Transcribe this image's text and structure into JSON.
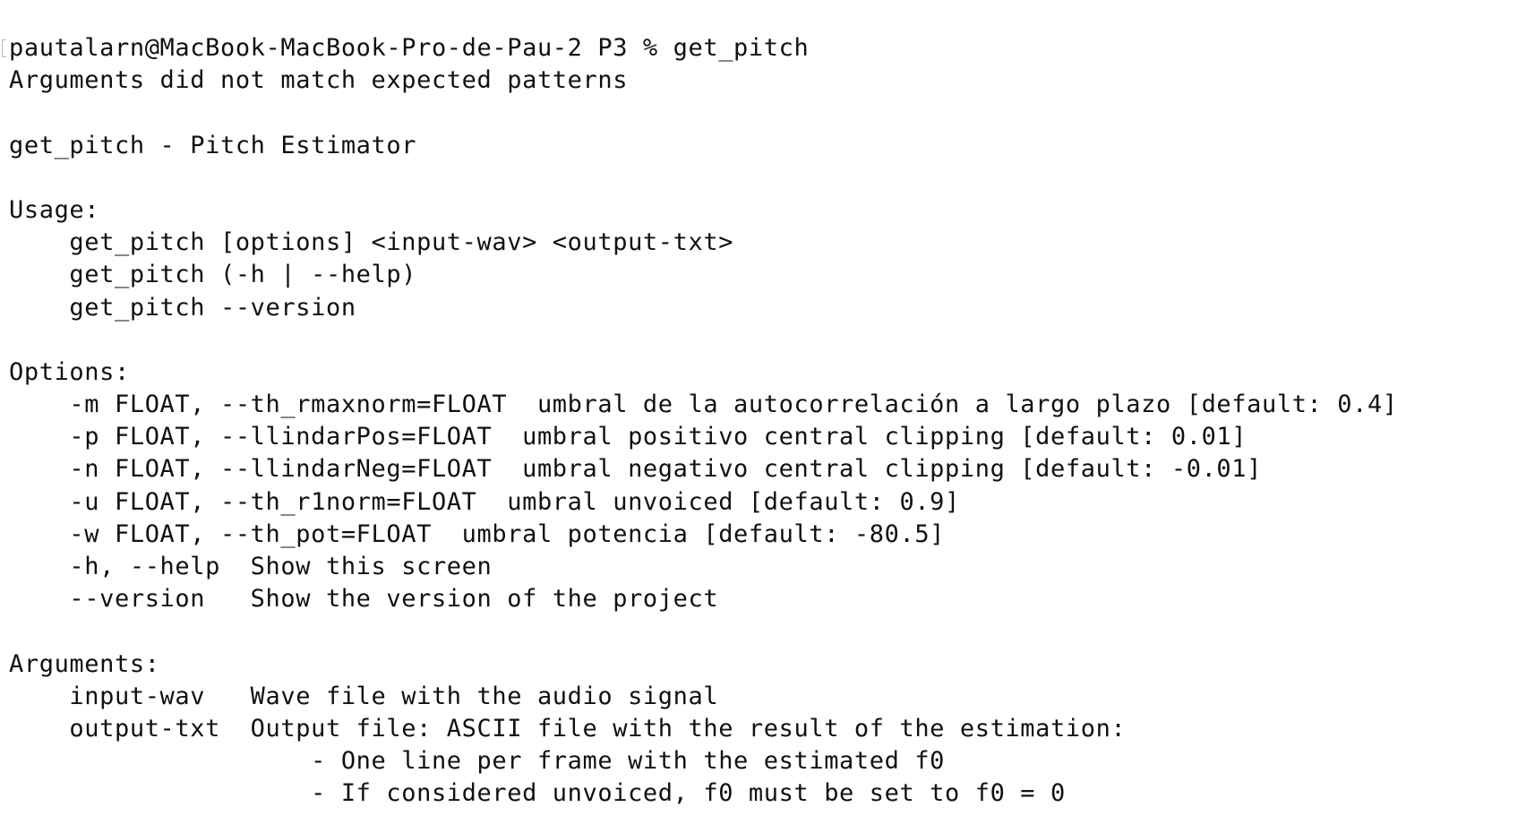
{
  "terminal": {
    "prompt": "pautalarn@MacBook-MacBook-Pro-de-Pau-2 P3 % get_pitch",
    "lines": [
      "Arguments did not match expected patterns",
      "",
      "get_pitch - Pitch Estimator",
      "",
      "Usage:",
      "    get_pitch [options] <input-wav> <output-txt>",
      "    get_pitch (-h | --help)",
      "    get_pitch --version",
      "",
      "Options:",
      "    -m FLOAT, --th_rmaxnorm=FLOAT  umbral de la autocorrelación a largo plazo [default: 0.4]",
      "    -p FLOAT, --llindarPos=FLOAT  umbral positivo central clipping [default: 0.01]",
      "    -n FLOAT, --llindarNeg=FLOAT  umbral negativo central clipping [default: -0.01]",
      "    -u FLOAT, --th_r1norm=FLOAT  umbral unvoiced [default: 0.9]",
      "    -w FLOAT, --th_pot=FLOAT  umbral potencia [default: -80.5]",
      "    -h, --help  Show this screen",
      "    --version   Show the version of the project",
      "",
      "Arguments:",
      "    input-wav   Wave file with the audio signal",
      "    output-txt  Output file: ASCII file with the result of the estimation:",
      "                    - One line per frame with the estimated f0",
      "                    - If considered unvoiced, f0 must be set to f0 = 0"
    ]
  }
}
